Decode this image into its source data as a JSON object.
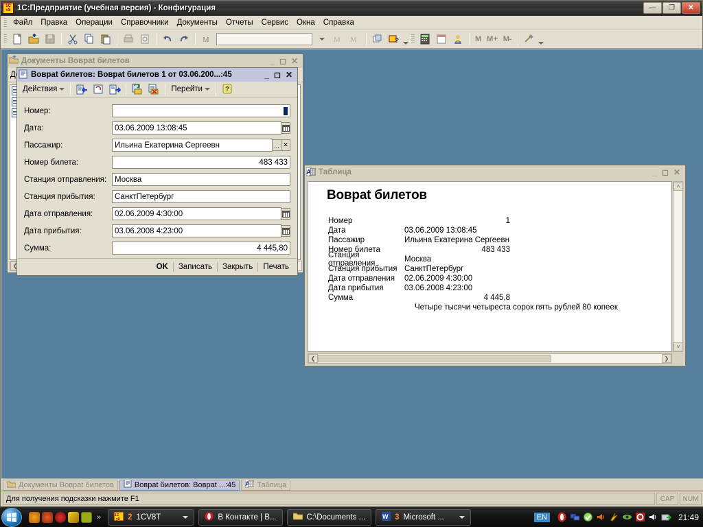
{
  "app": {
    "title": "1С:Предприятие (учебная версия) - Конфигурация",
    "logo_top": "1C",
    "logo_bottom": "v8",
    "minimize_label": "—",
    "restore_label": "❐",
    "close_label": "✕"
  },
  "menubar": {
    "items": [
      {
        "label": "Файл",
        "accel": "Ф"
      },
      {
        "label": "Правка",
        "accel": "П"
      },
      {
        "label": "Операции",
        "accel": ""
      },
      {
        "label": "Справочники",
        "accel": ""
      },
      {
        "label": "Документы",
        "accel": ""
      },
      {
        "label": "Отчеты",
        "accel": ""
      },
      {
        "label": "Сервис",
        "accel": "С"
      },
      {
        "label": "Окна",
        "accel": "О"
      },
      {
        "label": "Справка",
        "accel": ""
      }
    ]
  },
  "toolbar": {
    "search_value": "",
    "m_label": "M",
    "mplus_label": "M+",
    "mminus_label": "M-",
    "icons": [
      "new-document-icon",
      "open-folder-icon",
      "save-icon",
      "cut-icon",
      "copy-icon",
      "paste-icon",
      "print-icon",
      "print-preview-icon",
      "undo-icon",
      "redo-icon",
      "find-icon",
      "find-next-icon",
      "find-prev-icon",
      "windows-icon",
      "help-1c-icon",
      "calculator-icon",
      "calendar-icon",
      "user-icon",
      "tools-icon"
    ]
  },
  "doclist_window": {
    "title": "Документы Вовраt билетов",
    "title_text": "Документы Вовраt билетов",
    "icon": "folder-icon",
    "toolbar_first": "Дей",
    "rows_count": 3
  },
  "docform_window": {
    "title": "Вовраt билетов: Вовраt билетов 1 от 03.06.200...:45",
    "icon": "document-icon",
    "toolbar": {
      "actions_label": "Действия",
      "goto_label": "Перейти",
      "help_label": "?",
      "icons": [
        "post-document-icon",
        "undo-post-icon",
        "move-document-icon",
        "structure-icon",
        "clear-posting-icon"
      ]
    },
    "fields": [
      {
        "label": "Номер:",
        "value": "",
        "align": "right",
        "button": "cursor",
        "name": "number"
      },
      {
        "label": "Дата:",
        "value": "03.06.2009 13:08:45",
        "align": "left",
        "button": "calendar",
        "name": "date"
      },
      {
        "label": "Пассажир:",
        "value": "Ильина Екатерина Сергеевн",
        "align": "left",
        "button": "select-clear",
        "name": "passenger"
      },
      {
        "label": "Номер билета:",
        "value": "483 433",
        "align": "right",
        "button": "none",
        "name": "ticket-number"
      },
      {
        "label": "Станция отправления:",
        "value": "Москва",
        "align": "left",
        "button": "none",
        "name": "departure-station"
      },
      {
        "label": "Станция прибытия:",
        "value": "СанктПетербург",
        "align": "left",
        "button": "none",
        "name": "arrival-station"
      },
      {
        "label": "Дата отправления:",
        "value": "02.06.2009  4:30:00",
        "align": "left",
        "button": "calendar",
        "name": "departure-date"
      },
      {
        "label": "Дата прибытия:",
        "value": "03.06.2008  4:23:00",
        "align": "left",
        "button": "calendar",
        "name": "arrival-date"
      },
      {
        "label": "Сумма:",
        "value": "4 445,80",
        "align": "right",
        "button": "none",
        "name": "sum"
      }
    ],
    "footer_buttons": [
      {
        "label": "OK",
        "name": "ok-button"
      },
      {
        "label": "Записать",
        "name": "write-button"
      },
      {
        "label": "Закрыть",
        "name": "close-button"
      },
      {
        "label": "Печать",
        "name": "print-button"
      }
    ]
  },
  "table_window": {
    "title": "Таблица",
    "icon": "spreadsheet-icon",
    "report": {
      "title": "Вовраt билетов",
      "rows": [
        {
          "label": "Номер",
          "value": "1",
          "align": "num"
        },
        {
          "label": "Дата",
          "value": "03.06.2009 13:08:45",
          "align": "text"
        },
        {
          "label": "Пассажир",
          "value": "Ильина Екатерина Сергеевн",
          "align": "text"
        },
        {
          "label": "Номер билета",
          "value": "483 433",
          "align": "num"
        },
        {
          "label": "Станция отправления",
          "value": "Москва",
          "align": "text"
        },
        {
          "label": "Станция прибытия",
          "value": "СанктПетербург",
          "align": "text"
        },
        {
          "label": "Дата отправления",
          "value": "02.06.2009 4:30:00",
          "align": "text"
        },
        {
          "label": "Дата прибытия",
          "value": "03.06.2008 4:23:00",
          "align": "text"
        },
        {
          "label": "Сумма",
          "value": "4 445,8",
          "align": "num"
        }
      ],
      "amount_in_words": "Четыре тысячи четыреста сорок пять рублей 80 копеек"
    }
  },
  "window_tabs": [
    {
      "label": "Документы Вовраt билетов",
      "icon": "folder-icon",
      "active": false
    },
    {
      "label": "Вовраt билетов: Вовраt ...:45",
      "icon": "document-icon",
      "active": true
    },
    {
      "label": "Таблица",
      "icon": "spreadsheet-icon",
      "active": false
    }
  ],
  "statusbar": {
    "hint": "Для получения подсказки нажмите F1",
    "caps": "CAP",
    "num": "NUM"
  },
  "taskbar": {
    "start_label": "Пуск",
    "quicklaunch": [
      "at-icon",
      "browser-icon",
      "opera-icon",
      "flash-icon",
      "clock-app-icon"
    ],
    "overflow": "»",
    "buttons": [
      {
        "count": "2",
        "label": "1CV8T",
        "icon": "1c-icon",
        "dropdown": true
      },
      {
        "count": "",
        "label": "В Контакте | В...",
        "icon": "opera-icon",
        "dropdown": false
      },
      {
        "count": "",
        "label": "C:\\Documents ...",
        "icon": "folder-icon",
        "dropdown": false
      },
      {
        "count": "3",
        "label": "Microsoft ...",
        "icon": "word-icon",
        "dropdown": true
      }
    ],
    "language": "EN",
    "tray_icons": [
      "opera-icon",
      "network-icon",
      "antivirus-icon",
      "volume-icon",
      "flash-icon",
      "eye-icon",
      "record-icon",
      "speaker-icon",
      "eject-icon"
    ],
    "clock": "21:49"
  },
  "colors": {
    "desktop": "#3a6ea5",
    "mdi_background": "#567f9e",
    "window_face": "#e3dfd0",
    "active_title": "#c3c7de",
    "inactive_title": "#d6d2c2",
    "accent_blue": "#0a246a"
  }
}
